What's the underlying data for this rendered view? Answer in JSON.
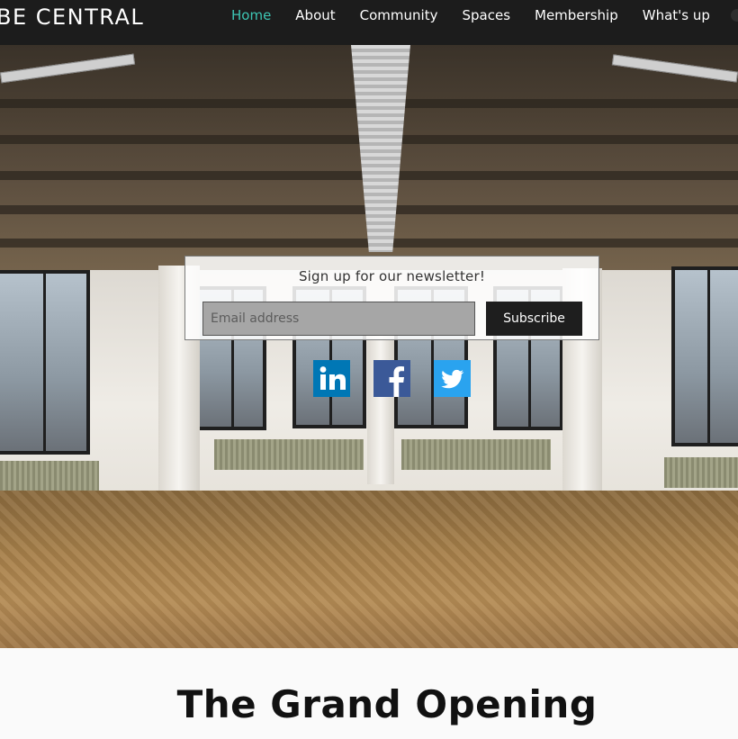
{
  "brand": {
    "logo_text": "BE CENTRAL"
  },
  "nav": {
    "items": [
      {
        "label": "Home",
        "active": true
      },
      {
        "label": "About",
        "active": false
      },
      {
        "label": "Community",
        "active": false
      },
      {
        "label": "Spaces",
        "active": false
      },
      {
        "label": "Membership",
        "active": false
      },
      {
        "label": "What's up",
        "active": false
      }
    ]
  },
  "colors": {
    "header_bg": "#1c1c1c",
    "nav_active": "#3dc6b4",
    "linkedin": "#0077b5",
    "facebook": "#3b5998",
    "twitter": "#2aa3ef"
  },
  "newsletter": {
    "title": "Sign up for our newsletter!",
    "email_placeholder": "Email address",
    "subscribe_label": "Subscribe"
  },
  "social": [
    {
      "network": "LinkedIn",
      "icon": "linkedin-icon"
    },
    {
      "network": "Facebook",
      "icon": "facebook-icon"
    },
    {
      "network": "Twitter",
      "icon": "twitter-icon"
    }
  ],
  "section": {
    "heading": "The Grand Opening"
  }
}
